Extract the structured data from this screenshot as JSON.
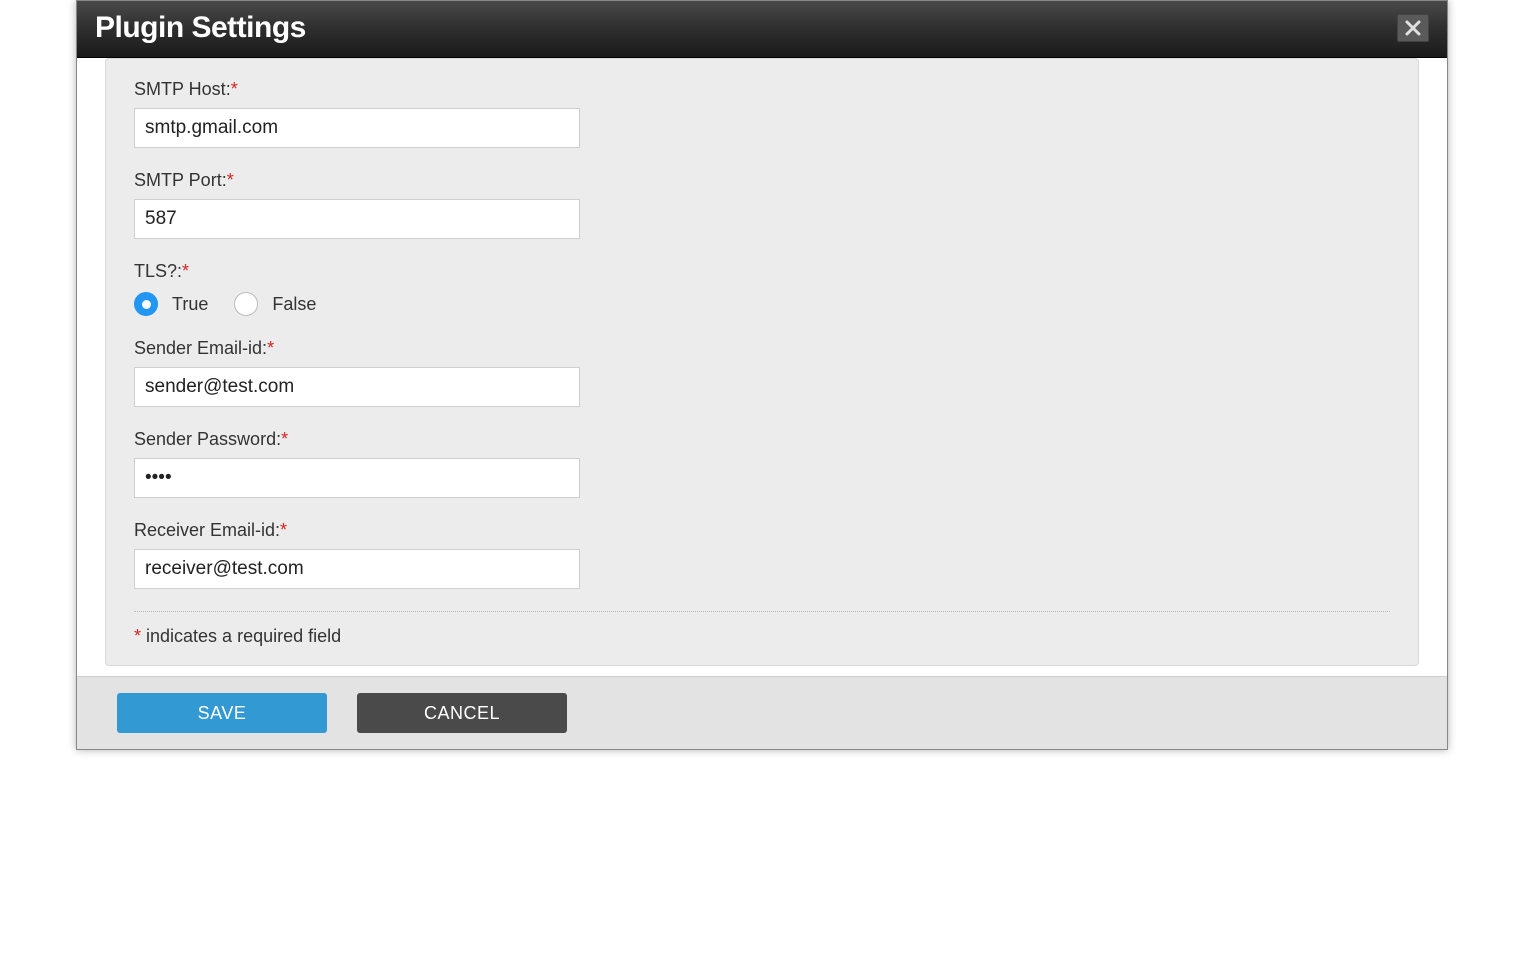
{
  "dialog": {
    "title": "Plugin Settings"
  },
  "form": {
    "fields": {
      "smtp_host": {
        "label": "SMTP Host:",
        "value": "smtp.gmail.com"
      },
      "smtp_port": {
        "label": "SMTP Port:",
        "value": "587"
      },
      "tls": {
        "label": "TLS?:",
        "option_true": "True",
        "option_false": "False",
        "selected": "true"
      },
      "sender_email": {
        "label": "Sender Email-id:",
        "value": "sender@test.com"
      },
      "sender_password": {
        "label": "Sender Password:",
        "value": "••••"
      },
      "receiver_email": {
        "label": "Receiver Email-id:",
        "value": "receiver@test.com"
      }
    },
    "required_marker": "*",
    "required_note_prefix": "*",
    "required_note_text": " indicates a required field"
  },
  "buttons": {
    "save": "SAVE",
    "cancel": "CANCEL"
  }
}
